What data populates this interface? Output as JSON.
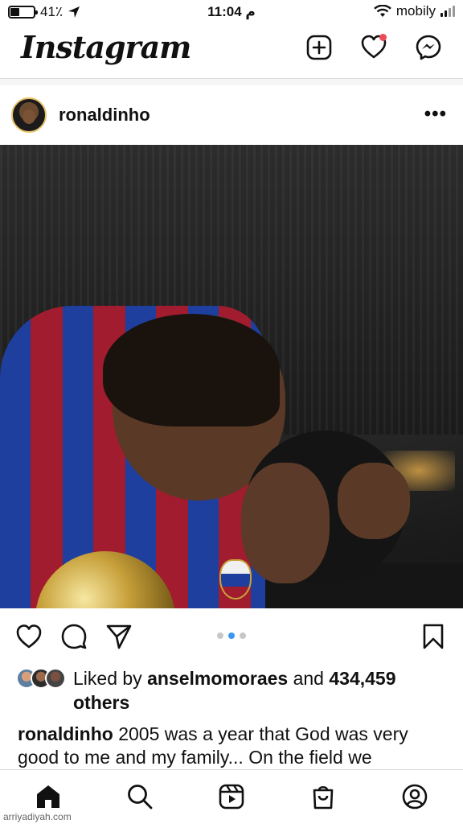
{
  "status_bar": {
    "battery_text": "41٪",
    "battery_level": 0.41,
    "time": "11:04 م",
    "carrier": "mobily"
  },
  "header": {
    "logo": "Instagram",
    "icons": [
      "new-post-icon",
      "heart-icon",
      "messenger-icon"
    ],
    "notification_dot_color": "#ed4956"
  },
  "post": {
    "username": "ronaldinho",
    "more_label": "•••",
    "carousel": {
      "count": 3,
      "active_index": 1
    },
    "likes": {
      "prefix": "Liked by ",
      "user": "anselmomoraes",
      "middle": " and ",
      "count": "434,459",
      "suffix": " others"
    },
    "caption": {
      "user": "ronaldinho",
      "text": " 2005 was a year that God was very good to me and my family... On the field we"
    }
  },
  "actions": [
    "like-icon",
    "comment-icon",
    "share-icon",
    "save-icon"
  ],
  "bottom_nav": [
    "home-icon",
    "search-icon",
    "reels-icon",
    "shop-icon",
    "profile-icon"
  ],
  "watermark": "arriyadiyah.com",
  "colors": {
    "accent_blue": "#3897f0",
    "divider": "#dbdbdb"
  }
}
